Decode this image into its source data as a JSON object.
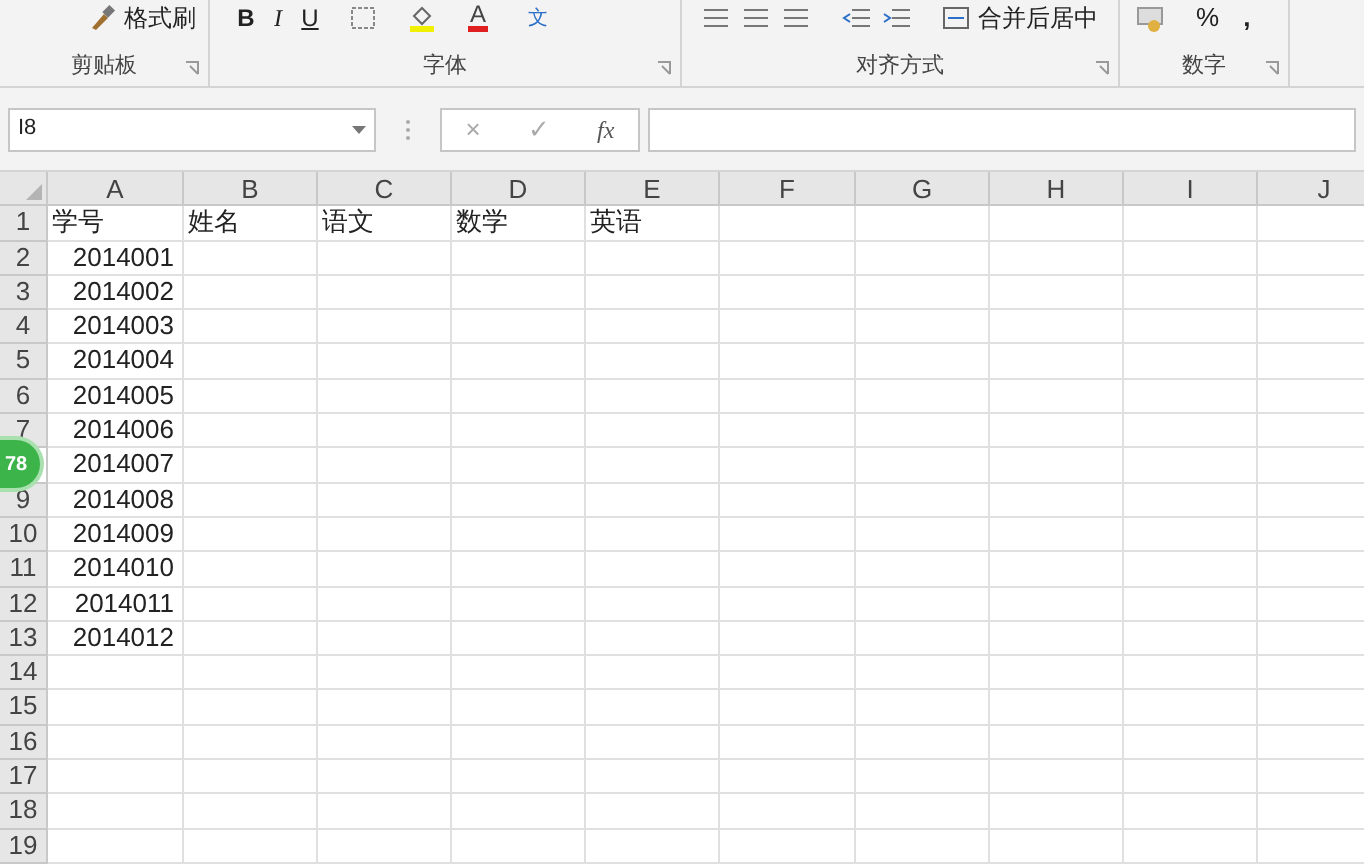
{
  "ribbon": {
    "groups": [
      {
        "label": "剪贴板",
        "tools": [
          {
            "kind": "brush",
            "text": "格式刷"
          }
        ]
      },
      {
        "label": "字体",
        "tools": [
          {
            "kind": "bold",
            "text": "B"
          },
          {
            "kind": "italic",
            "text": "I"
          },
          {
            "kind": "underline",
            "text": "U"
          },
          {
            "kind": "border"
          },
          {
            "kind": "fill"
          },
          {
            "kind": "fontcolor",
            "text": "A"
          },
          {
            "kind": "phonetic",
            "text": "文"
          }
        ]
      },
      {
        "label": "对齐方式",
        "tools": [
          {
            "kind": "align"
          },
          {
            "kind": "indent"
          },
          {
            "kind": "merge",
            "text": "合并后居中"
          }
        ]
      },
      {
        "label": "数字",
        "tools": [
          {
            "kind": "format"
          },
          {
            "kind": "percent",
            "text": "%"
          },
          {
            "kind": "comma",
            "text": ","
          }
        ]
      }
    ]
  },
  "formula_bar": {
    "name_box": "I8",
    "cancel": "×",
    "enter": "✓",
    "fx": "fx"
  },
  "sheet": {
    "columns": [
      "A",
      "B",
      "C",
      "D",
      "E",
      "F",
      "G",
      "H",
      "I",
      "J"
    ],
    "rows": [
      {
        "number": "1",
        "cells": [
          "学号",
          "姓名",
          "语文",
          "数学",
          "英语"
        ]
      },
      {
        "number": "2",
        "cells": [
          "2014001"
        ]
      },
      {
        "number": "3",
        "cells": [
          "2014002"
        ]
      },
      {
        "number": "4",
        "cells": [
          "2014003"
        ]
      },
      {
        "number": "5",
        "cells": [
          "2014004"
        ]
      },
      {
        "number": "6",
        "cells": [
          "2014005"
        ]
      },
      {
        "number": "7",
        "cells": [
          "2014006"
        ]
      },
      {
        "cells": [
          "2014007"
        ]
      },
      {
        "number": "9",
        "cells": [
          "2014008"
        ]
      },
      {
        "number": "10",
        "cells": [
          "2014009"
        ]
      },
      {
        "number": "11",
        "cells": [
          "2014010"
        ]
      },
      {
        "number": "12",
        "cells": [
          "2014011"
        ]
      },
      {
        "number": "13",
        "cells": [
          "2014012"
        ]
      },
      {
        "number": "14",
        "cells": []
      },
      {
        "number": "15",
        "cells": []
      },
      {
        "number": "16",
        "cells": []
      },
      {
        "number": "17",
        "cells": []
      },
      {
        "number": "18",
        "cells": []
      },
      {
        "number": "19",
        "cells": []
      }
    ]
  },
  "floating_ball": {
    "text": "78"
  }
}
